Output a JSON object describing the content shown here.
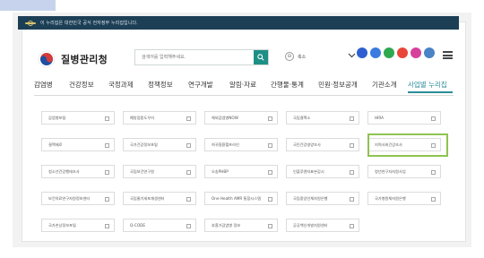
{
  "gov_banner": {
    "text": "이 누리집은 대한민국 공식 전자정부 누리집입니다."
  },
  "header": {
    "logo_text": "질병관리청",
    "search_placeholder": "검색어를 입력해주세요.",
    "zoom_label": "축소",
    "zoom_symbol": "⊖"
  },
  "nav": {
    "items": [
      "감염병",
      "건강정보",
      "국정과제",
      "정책정보",
      "연구개발",
      "알림·자료",
      "간행물·통계",
      "민원·정보공개",
      "기관소개",
      "사업별 누리집"
    ],
    "active_index": 9
  },
  "sites": [
    [
      "감염병포털",
      "예방접종도우미",
      "해외감염병NOW",
      "국립결핵소",
      "HIRA"
    ],
    [
      "결핵제로",
      "국가건강정보포털",
      "희귀질환헬프라인",
      "국민건강영양조사",
      "지역사회건강조사"
    ],
    [
      "청소년건강행태조사",
      "국립보건연구원",
      "오송PHBP",
      "인플루엔자표본감시",
      "청년연구자지원사업"
    ],
    [
      "보건의료연구자원정보센터",
      "국립줄기세포재생센터",
      "One Health AMR 통합시스템",
      "국립중앙인체자원은행",
      "국가병원체자원은행"
    ],
    [
      "국가손상정보포털",
      "Q-CODE",
      "호흡기감염병 정보",
      "공공백신개발지원센터"
    ]
  ],
  "highlighted_site": "지역사회건강조사",
  "colors": {
    "banner": "#1c3f56",
    "accent": "#2b8d9b",
    "search_button": "#1d8f87",
    "highlight": "#8ec351",
    "social": [
      "#2d5fd0",
      "#3b7ae0",
      "#2ea84f",
      "#e8463a",
      "#d6419c",
      "#4a83c6"
    ]
  },
  "social_icons": [
    "youtube-icon",
    "facebook-icon",
    "blog-icon",
    "instagram-icon",
    "insta2-icon",
    "kakao-icon"
  ]
}
